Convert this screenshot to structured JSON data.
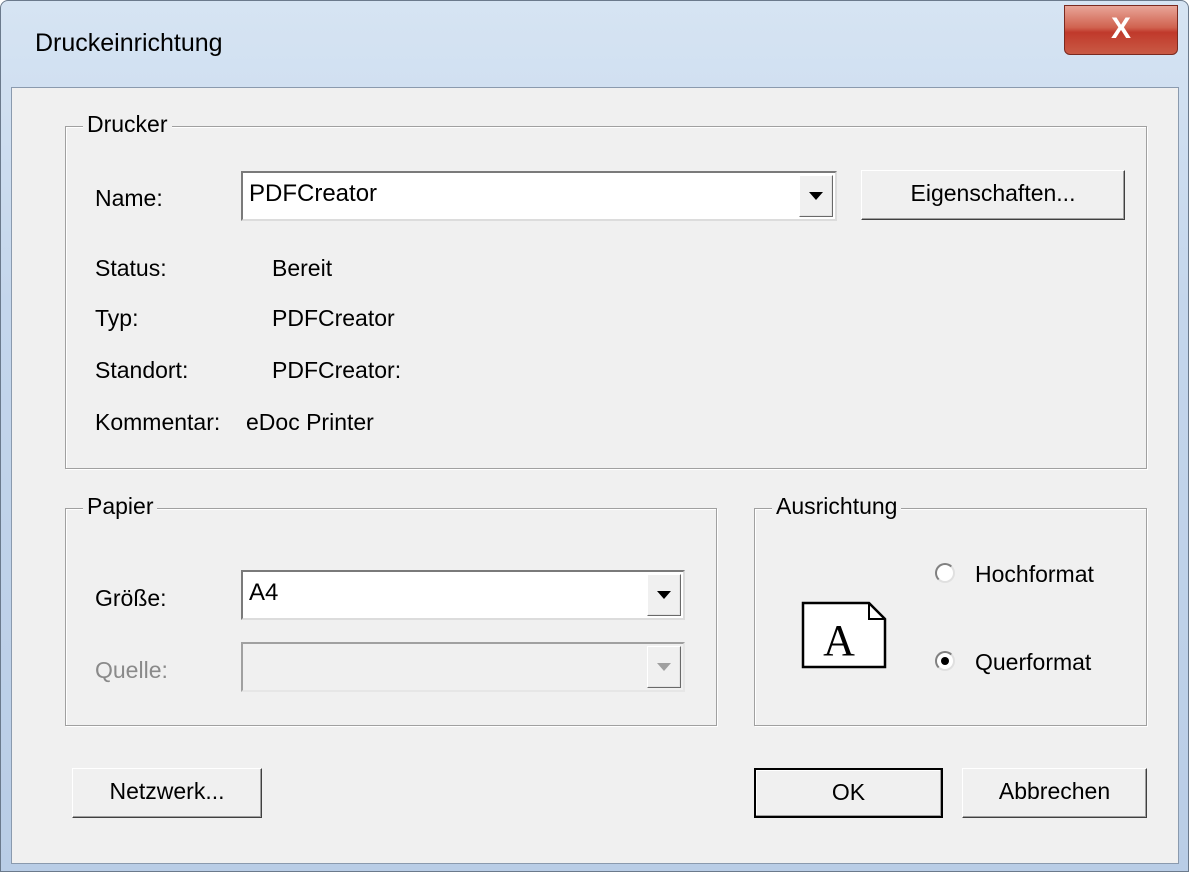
{
  "window": {
    "title": "Druckeinrichtung",
    "close_glyph": "X"
  },
  "drucker": {
    "legend": "Drucker",
    "name_label": "Name:",
    "name_value": "PDFCreator",
    "eigenschaften_button": "Eigenschaften...",
    "status_label": "Status:",
    "status_value": "Bereit",
    "typ_label": "Typ:",
    "typ_value": "PDFCreator",
    "standort_label": "Standort:",
    "standort_value": "PDFCreator:",
    "kommentar_label": "Kommentar:",
    "kommentar_value": "eDoc Printer"
  },
  "papier": {
    "legend": "Papier",
    "groesse_label": "Größe:",
    "groesse_value": "A4",
    "quelle_label": "Quelle:",
    "quelle_value": ""
  },
  "ausrichtung": {
    "legend": "Ausrichtung",
    "preview_letter": "A",
    "hochformat_label": "Hochformat",
    "querformat_label": "Querformat",
    "selected": "Querformat"
  },
  "buttons": {
    "netzwerk": "Netzwerk...",
    "ok": "OK",
    "abbrechen": "Abbrechen"
  },
  "icons": {
    "close": "close-icon",
    "dropdown": "chevron-down-icon",
    "orientation": "page-orientation-icon"
  }
}
